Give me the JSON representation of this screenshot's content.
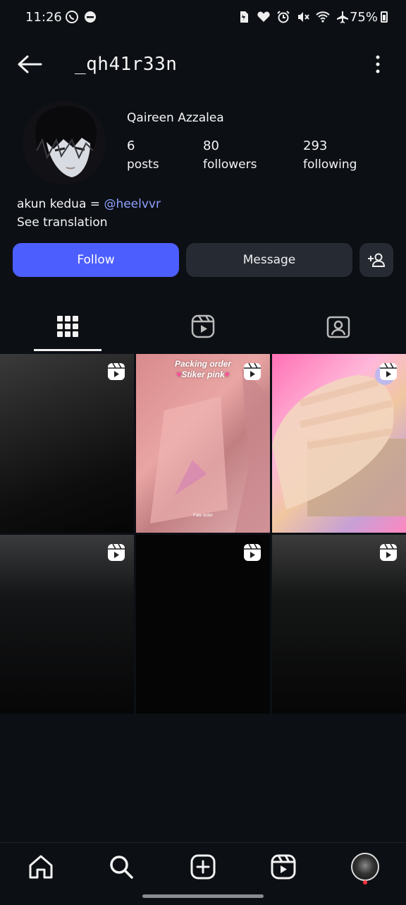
{
  "status_bar": {
    "time": "11:26",
    "battery": "75%",
    "icons": [
      "whatsapp-icon",
      "dnd-icon",
      "sim-icon",
      "heart-icon",
      "alarm-icon",
      "mute-icon",
      "wifi-icon",
      "airplane-icon"
    ]
  },
  "header": {
    "username": "_qh41r33n"
  },
  "profile": {
    "full_name": "Qaireen Azzalea",
    "stats": [
      {
        "number": "6",
        "label": "posts"
      },
      {
        "number": "80",
        "label": "followers"
      },
      {
        "number": "293",
        "label": "following"
      }
    ],
    "bio_prefix": "akun kedua = ",
    "bio_mention": "@heelvvr",
    "see_translation": "See translation"
  },
  "actions": {
    "follow_label": "Follow",
    "message_label": "Message"
  },
  "tabs": [
    {
      "name": "posts-grid-icon",
      "active": true
    },
    {
      "name": "reels-icon",
      "active": false
    },
    {
      "name": "tagged-icon",
      "active": false
    }
  ],
  "posts": [
    {
      "type": "reel"
    },
    {
      "type": "reel",
      "overlay_line1": "Packing order",
      "overlay_line2": "Stiker pink",
      "overlay_small": "Fate order"
    },
    {
      "type": "reel"
    },
    {
      "type": "reel"
    },
    {
      "type": "reel"
    },
    {
      "type": "reel"
    }
  ],
  "colors": {
    "background": "#0c0f14",
    "follow_button": "#4d5eff",
    "secondary_button": "#262a33",
    "mention": "#8ea0ff",
    "notification_dot": "#ff3040"
  },
  "bottom_nav": [
    "home-icon",
    "search-icon",
    "create-icon",
    "reels-icon",
    "profile-avatar"
  ]
}
